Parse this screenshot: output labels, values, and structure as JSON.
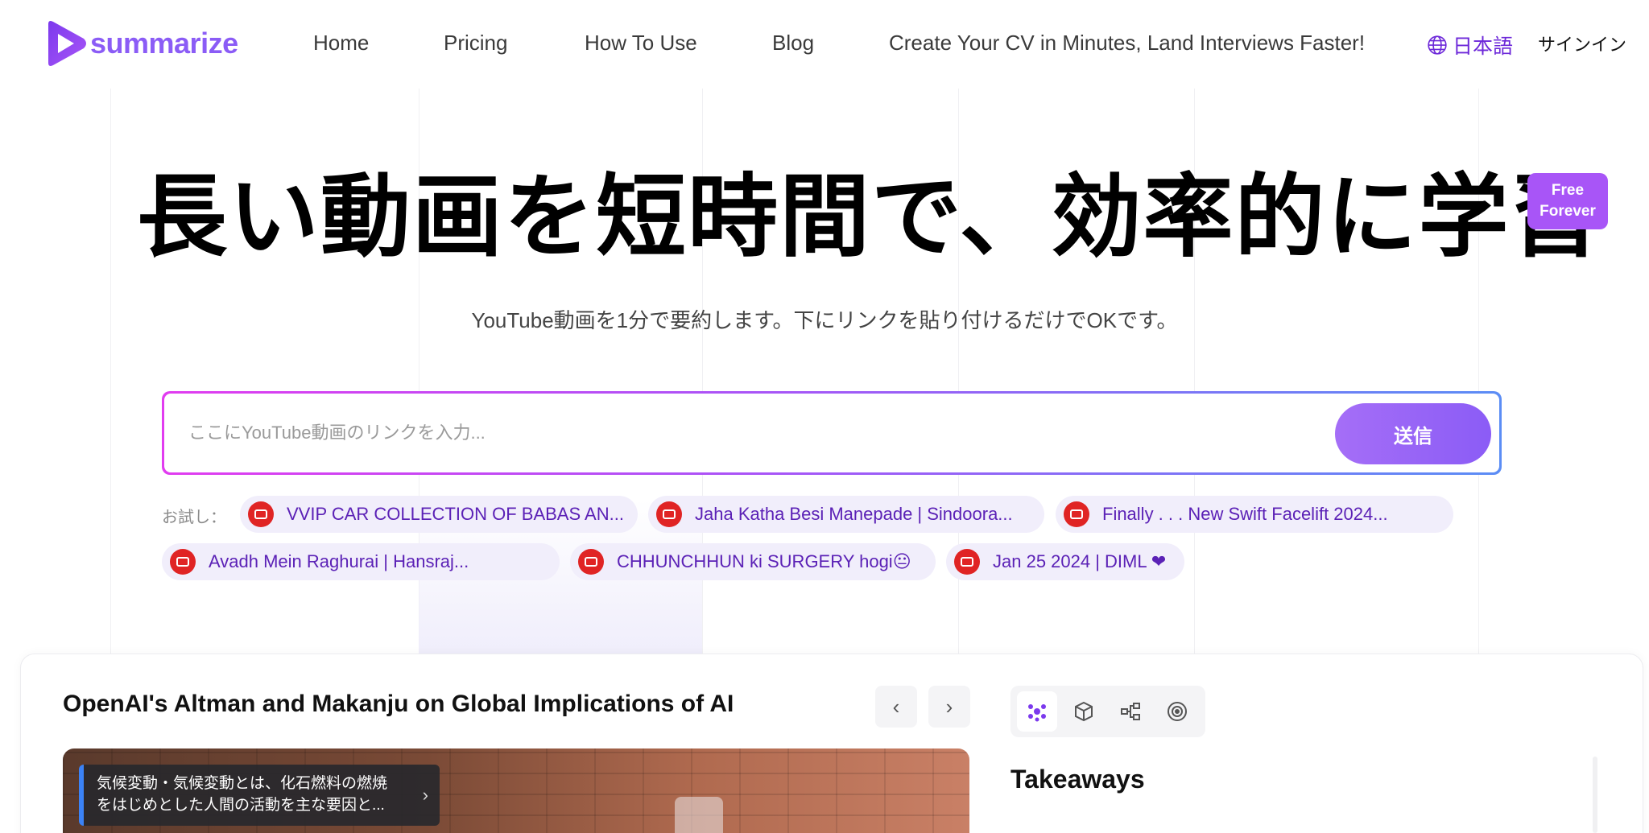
{
  "brand": {
    "name": "summarize",
    "color": "#8b5cf6"
  },
  "nav": {
    "items": [
      {
        "label": "Home"
      },
      {
        "label": "Pricing"
      },
      {
        "label": "How To Use"
      },
      {
        "label": "Blog"
      },
      {
        "label": "Create Your CV in Minutes, Land Interviews Faster!"
      }
    ],
    "language": "日本語",
    "signin": "サインイン"
  },
  "hero": {
    "title": "長い動画を短時間で、効率的に学習",
    "badge_line1": "Free",
    "badge_line2": "Forever",
    "subtitle": "YouTube動画を1分で要約します。下にリンクを貼り付けるだけでOKです。"
  },
  "search": {
    "placeholder": "ここにYouTube動画のリンクを入力...",
    "value": "",
    "submit_label": "送信"
  },
  "try": {
    "label": "お試し：",
    "chips": [
      {
        "label": "VVIP CAR COLLECTION OF BABAS AN..."
      },
      {
        "label": "Jaha Katha Besi Manepade | Sindoora..."
      },
      {
        "label": "Finally . . . New Swift Facelift 2024..."
      },
      {
        "label": "Avadh Mein Raghurai | Hansraj..."
      },
      {
        "label": "CHHUNCHHUN ki SURGERY hogi😐"
      },
      {
        "label": "Jan 25 2024 | DIML ❤"
      }
    ]
  },
  "summary_card": {
    "title": "OpenAI's Altman and Makanju on Global Implications of AI",
    "prev_icon": "‹",
    "next_icon": "›",
    "caption_line1": "気候変動・気候変動とは、化石燃料の燃焼",
    "caption_line2": "をはじめとした人間の活動を主な要因と...",
    "caption_chevron": "›",
    "tools": [
      "mindmap-icon",
      "cube-icon",
      "flowchart-icon",
      "target-icon"
    ],
    "section_title": "Takeaways"
  }
}
